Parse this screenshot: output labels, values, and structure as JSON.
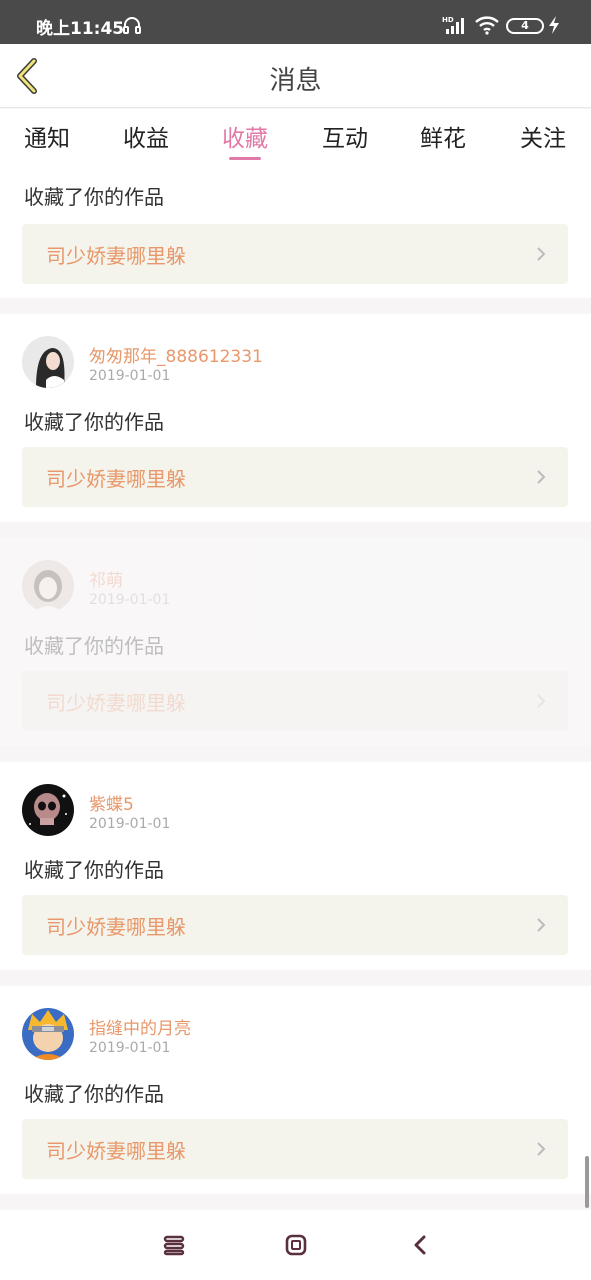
{
  "status_bar": {
    "time": "晚上11:45",
    "network": "HD",
    "battery": "4",
    "icons": [
      "headset-icon",
      "signal-icon",
      "wifi-icon",
      "battery-icon",
      "charging-icon"
    ]
  },
  "header": {
    "title": "消息",
    "back_icon": "chevron-left-icon"
  },
  "tabs": [
    {
      "label": "通知",
      "active": false
    },
    {
      "label": "收益",
      "active": false
    },
    {
      "label": "收藏",
      "active": true
    },
    {
      "label": "互动",
      "active": false
    },
    {
      "label": "鲜花",
      "active": false
    },
    {
      "label": "关注",
      "active": false
    }
  ],
  "messages": [
    {
      "user": "",
      "date": "",
      "action": "收藏了你的作品",
      "work_title": "司少娇妻哪里躲"
    },
    {
      "user": "匆匆那年_888612331",
      "date": "2019-01-01",
      "action": "收藏了你的作品",
      "work_title": "司少娇妻哪里躲"
    },
    {
      "user": "祁萌",
      "date": "2019-01-01",
      "action": "收藏了你的作品",
      "work_title": "司少娇妻哪里躲"
    },
    {
      "user": "紫蝶5",
      "date": "2019-01-01",
      "action": "收藏了你的作品",
      "work_title": "司少娇妻哪里躲"
    },
    {
      "user": "指缝中的月亮",
      "date": "2019-01-01",
      "action": "收藏了你的作品",
      "work_title": "司少娇妻哪里躲"
    }
  ],
  "colors": {
    "accent": "#e27aa7",
    "username": "#e8986a",
    "work_bg": "#f5f4ec",
    "status_bar": "#4a4a4a"
  },
  "nav_icons": [
    "menu-icon",
    "home-icon",
    "back-icon"
  ]
}
